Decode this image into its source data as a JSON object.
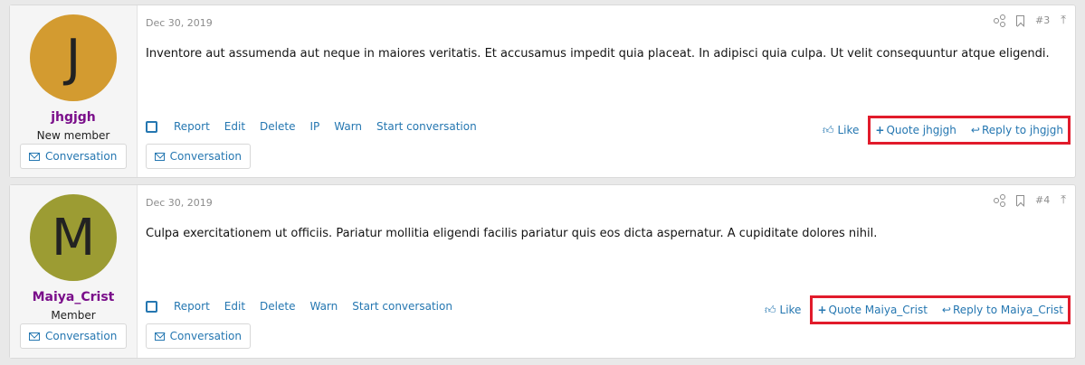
{
  "posts": [
    {
      "avatar_letter": "J",
      "avatar_color": "#d39b30",
      "username": "jhgjgh",
      "user_title": "New member",
      "conversation_label": "Conversation",
      "date": "Dec 30, 2019",
      "post_number": "#3",
      "content": "Inventore aut assumenda aut neque in maiores veritatis. Et accusamus impedit quia placeat. In adipisci quia culpa. Ut velit consequuntur atque eligendi.",
      "actions": [
        "Report",
        "Edit",
        "Delete",
        "IP",
        "Warn",
        "Start conversation"
      ],
      "like_label": "Like",
      "quote_label": "Quote jhgjgh",
      "reply_label": "Reply to jhgjgh"
    },
    {
      "avatar_letter": "M",
      "avatar_color": "#9c9c33",
      "username": "Maiya_Crist",
      "user_title": "Member",
      "conversation_label": "Conversation",
      "date": "Dec 30, 2019",
      "post_number": "#4",
      "content": "Culpa exercitationem ut officiis. Pariatur mollitia eligendi facilis pariatur quis eos dicta aspernatur. A cupiditate dolores nihil.",
      "actions": [
        "Report",
        "Edit",
        "Delete",
        "Warn",
        "Start conversation"
      ],
      "like_label": "Like",
      "quote_label": "Quote Maiya_Crist",
      "reply_label": "Reply to Maiya_Crist"
    }
  ],
  "icons": {
    "share": "share-icon",
    "bookmark": "bookmark-icon",
    "top": "arrow-to-top-icon",
    "like": "thumbs-up-icon",
    "reply": "reply-icon",
    "conversation": "envelope-icon"
  },
  "highlight_color": "#e11b2b",
  "link_color": "#2577b1",
  "username_color": "#7a0e8a"
}
